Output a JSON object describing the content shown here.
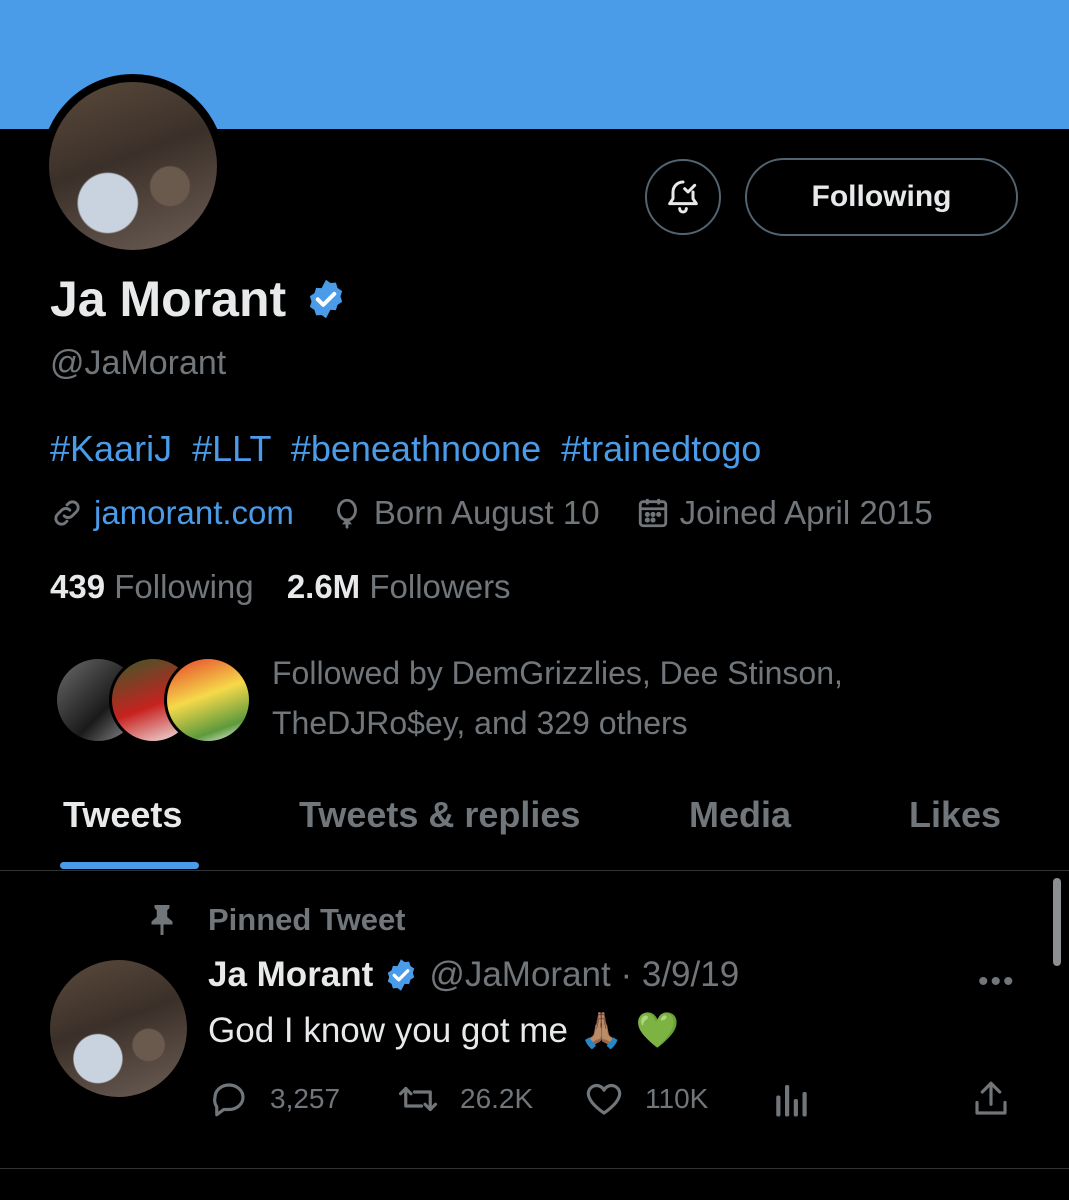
{
  "profile": {
    "display_name": "Ja Morant",
    "handle": "@JaMorant",
    "bio_hashtags": [
      "#KaariJ",
      "#LLT",
      "#beneathnoone",
      "#trainedtogo"
    ],
    "website": "jamorant.com",
    "born": "Born August 10",
    "joined": "Joined April 2015",
    "following_count": "439",
    "following_label": "Following",
    "followers_count": "2.6M",
    "followers_label": "Followers",
    "followed_by_line1": "Followed by DemGrizzlies, Dee Stinson,",
    "followed_by_line2": "TheDJRo$ey, and 329 others"
  },
  "header": {
    "follow_button_label": "Following",
    "banner_color": "#4a9be8"
  },
  "tabs": [
    {
      "label": "Tweets",
      "active": true
    },
    {
      "label": "Tweets & replies",
      "active": false
    },
    {
      "label": "Media",
      "active": false
    },
    {
      "label": "Likes",
      "active": false
    }
  ],
  "pinned_tweet": {
    "pinned_label": "Pinned Tweet",
    "author_name": "Ja Morant",
    "author_handle": "@JaMorant",
    "separator": " · ",
    "date": "3/9/19",
    "text": "God I know you got me",
    "emojis": [
      "🙏🏽",
      "💚"
    ],
    "replies": "3,257",
    "retweets": "26.2K",
    "likes": "110K",
    "more_label": "•••"
  },
  "colors": {
    "accent": "#4a9be8",
    "muted": "#71767b",
    "background": "#000000",
    "text": "#e7e9ea"
  }
}
